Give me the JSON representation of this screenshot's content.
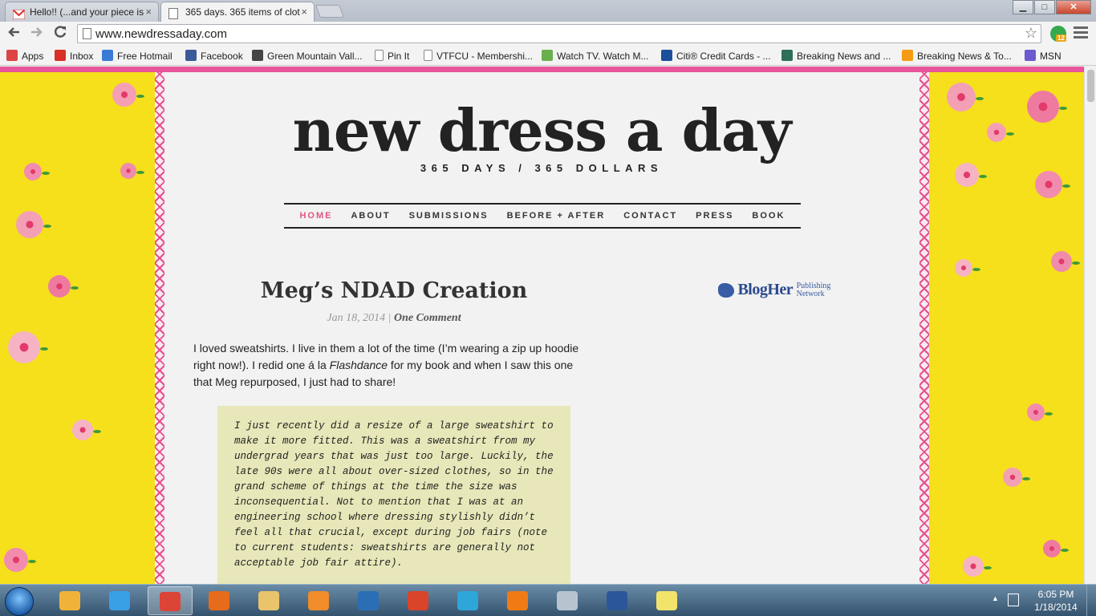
{
  "browser": {
    "tabs": [
      {
        "title": "Hello!! (...and your piece is",
        "favicon": "gmail-icon",
        "active": false
      },
      {
        "title": "365 days. 365 items of clot",
        "favicon": "page-icon",
        "active": true
      }
    ],
    "close_glyph": "×",
    "address": "www.newdressaday.com",
    "extension_badge": "12",
    "window_controls": {
      "minimize": "▁",
      "maximize": "□",
      "close": "✕"
    },
    "bookmarks": [
      {
        "label": "Apps",
        "icon": "apps-grid-icon",
        "color": "#d44"
      },
      {
        "label": "Inbox",
        "icon": "gmail-icon",
        "color": "#d93025"
      },
      {
        "label": "Free Hotmail",
        "icon": "windows-icon",
        "color": "#3a7bd5"
      },
      {
        "label": "Facebook",
        "icon": "facebook-icon",
        "color": "#3b5998"
      },
      {
        "label": "Green Mountain Vall...",
        "icon": "ed-icon",
        "color": "#444"
      },
      {
        "label": "Pin It",
        "icon": "page-icon",
        "color": "#fff"
      },
      {
        "label": "VTFCU - Membershi...",
        "icon": "page-icon",
        "color": "#fff"
      },
      {
        "label": "Watch TV. Watch M...",
        "icon": "hulu-icon",
        "color": "#6ab04c"
      },
      {
        "label": "Citi® Credit Cards - ...",
        "icon": "citi-icon",
        "color": "#1b4f9c"
      },
      {
        "label": "Breaking News and ...",
        "icon": "huffpost-icon",
        "color": "#2e6f5a"
      },
      {
        "label": "Breaking News & To...",
        "icon": "nbc-icon",
        "color": "#f39c12"
      },
      {
        "label": "MSN",
        "icon": "msn-icon",
        "color": "#6a5acd"
      }
    ]
  },
  "site": {
    "title": "new dress a day",
    "tagline": "365 DAYS / 365 DOLLARS",
    "nav": [
      {
        "label": "HOME",
        "current": true
      },
      {
        "label": "ABOUT",
        "current": false
      },
      {
        "label": "SUBMISSIONS",
        "current": false
      },
      {
        "label": "BEFORE + AFTER",
        "current": false
      },
      {
        "label": "CONTACT",
        "current": false
      },
      {
        "label": "PRESS",
        "current": false
      },
      {
        "label": "BOOK",
        "current": false
      }
    ],
    "accent_color": "#e0567e"
  },
  "post": {
    "title": "Meg’s NDAD Creation",
    "date": "Jan 18, 2014",
    "separator": " | ",
    "comments": "One Comment",
    "body_before": "I loved sweatshirts. I live in them a lot of the time (I’m wearing a zip up hoodie right now!). I redid one á la ",
    "body_em": "Flashdance",
    "body_after": " for my book and when I saw this one that Meg repurposed, I just had to share!",
    "quote": "I just recently did a resize of a large sweatshirt to make it more fitted. This was a sweatshirt from my undergrad years that was just too large. Luckily, the late 90s were all about over-sized clothes, so in the grand scheme of things at the time the size was inconsequential. Not to mention that I was at an engineering school where dressing stylishly didn’t feel all that crucial, except during job fairs (note to current students: sweatshirts are generally not acceptable job fair attire)."
  },
  "sidebar": {
    "blogher_word": "BlogHer",
    "blogher_sub_1": "Publishing",
    "blogher_sub_2": "Network"
  },
  "taskbar": {
    "time": "6:05 PM",
    "date": "1/18/2014",
    "tray_expand": "▲",
    "items": [
      {
        "name": "outlook-icon",
        "color": "#f0b33a",
        "active": false
      },
      {
        "name": "internet-explorer-icon",
        "color": "#3aa0e6",
        "active": false
      },
      {
        "name": "chrome-icon",
        "color": "#db4437",
        "active": true
      },
      {
        "name": "firefox-icon",
        "color": "#e66b1a",
        "active": false
      },
      {
        "name": "file-explorer-icon",
        "color": "#e9c46a",
        "active": false
      },
      {
        "name": "media-player-icon",
        "color": "#f08c2a",
        "active": false
      },
      {
        "name": "hp-icon",
        "color": "#2a6fb5",
        "active": false
      },
      {
        "name": "office-upload-icon",
        "color": "#d9442a",
        "active": false
      },
      {
        "name": "network-globe-icon",
        "color": "#2fa6d9",
        "active": false
      },
      {
        "name": "avast-icon",
        "color": "#f07b14",
        "active": false
      },
      {
        "name": "math-input-icon",
        "color": "#b7c4d0",
        "active": false
      },
      {
        "name": "word-icon",
        "color": "#2b579a",
        "active": false
      },
      {
        "name": "sticky-notes-icon",
        "color": "#f2e36b",
        "active": false
      }
    ]
  }
}
